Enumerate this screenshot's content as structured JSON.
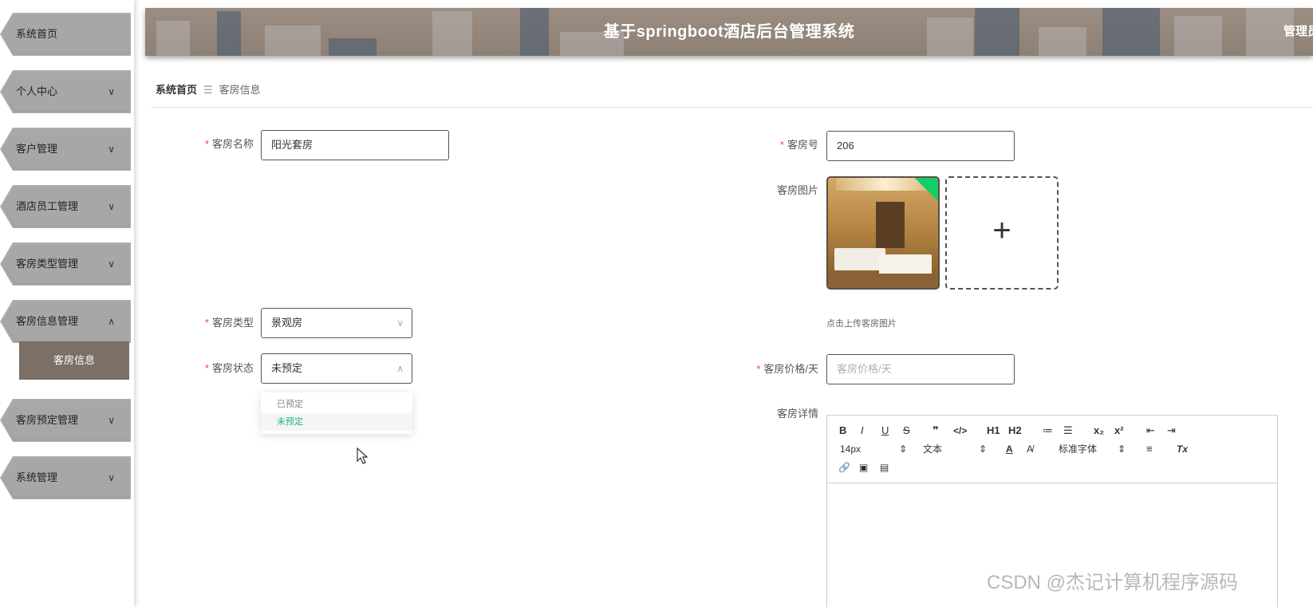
{
  "header": {
    "title": "基于springboot酒店后台管理系统",
    "admin": "管理员"
  },
  "sidebar": {
    "items": [
      {
        "label": "系统首页",
        "chevron": ""
      },
      {
        "label": "个人中心",
        "chevron": "∨"
      },
      {
        "label": "客户管理",
        "chevron": "∨"
      },
      {
        "label": "酒店员工管理",
        "chevron": "∨"
      },
      {
        "label": "客房类型管理",
        "chevron": "∨"
      },
      {
        "label": "客房信息管理",
        "chevron": "∧"
      },
      {
        "label": "客房预定管理",
        "chevron": "∨"
      },
      {
        "label": "系统管理",
        "chevron": "∨"
      }
    ],
    "subitem": {
      "label": "客房信息"
    }
  },
  "breadcrumb": {
    "home": "系统首页",
    "separator": "☰",
    "current": "客房信息"
  },
  "form": {
    "room_name": {
      "label": "客房名称",
      "value": "阳光套房"
    },
    "room_no": {
      "label": "客房号",
      "value": "206"
    },
    "room_image": {
      "label": "客房图片",
      "tip": "点击上传客房图片",
      "plus": "+"
    },
    "room_type": {
      "label": "客房类型",
      "value": "景观房",
      "arrow": "∨"
    },
    "room_status": {
      "label": "客房状态",
      "value": "未预定",
      "arrow": "∧",
      "options": [
        "已预定",
        "未预定"
      ]
    },
    "room_price": {
      "label": "客房价格/天",
      "placeholder": "客房价格/天"
    },
    "room_detail": {
      "label": "客房详情"
    }
  },
  "editor": {
    "row1": [
      "B",
      "I",
      "U",
      "S",
      "❞",
      "</>",
      "H1",
      "H2",
      "≔",
      "☰",
      "x₂",
      "x²",
      "⇤",
      "⇥"
    ],
    "row2": [
      "14px",
      "⇕",
      "文本",
      "⇕",
      "A",
      "A̸",
      "标准字体",
      "⇕",
      "≡",
      "Tx"
    ],
    "row3": [
      "🔗",
      "▣",
      "▤"
    ]
  },
  "watermark": "CSDN @杰记计算机程序源码",
  "colors": {
    "accent": "#20b282",
    "required": "#e24a4a",
    "nav": "#a7a7a7",
    "active": "#7b6f66"
  }
}
